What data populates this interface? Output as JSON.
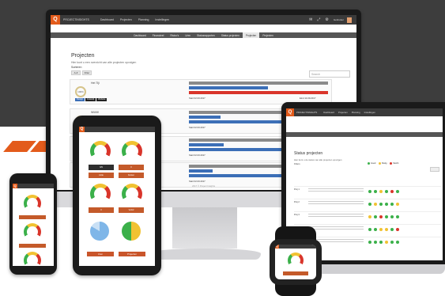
{
  "brand": {
    "logo_letter": "Q",
    "name": "PROJECTINSIGHTS"
  },
  "colors": {
    "accent": "#e35b1b",
    "dark_bar": "#3a3a3a",
    "sub_bar": "#555555",
    "gantt_blue": "#3c6fb7",
    "gantt_red": "#d9352b",
    "gantt_gray": "#8a8a8a"
  },
  "monitor": {
    "top_nav": [
      "Dashboard",
      "Projecten",
      "Planning",
      "Instellingen"
    ],
    "user_label": "Gebruiker",
    "sub_nav": [
      "Dashboard",
      "Financieel",
      "Risico's",
      "Uren",
      "Statusrapporten",
      "Status projecten",
      "Projecten",
      "Projecten"
    ],
    "active_sub_index": 6,
    "page_title": "Projecten",
    "page_subtitle": "Hier kunt u een overzicht van alle projecten opvolgen",
    "sort_label": "Sorteren",
    "sort_buttons": [
      "A-Z",
      "Filter"
    ],
    "search_placeholder": "Search",
    "rows": [
      {
        "name": "Het Tiji",
        "percent": "100%",
        "start": "Start 02.03.2017",
        "end": "Eind 14.09.2017"
      },
      {
        "name": "WWW",
        "percent": "100%",
        "start": "Start 02.03.2017",
        "end": ""
      },
      {
        "name": "",
        "percent": "",
        "start": "Start 02.03.2017",
        "end": ""
      },
      {
        "name": "",
        "percent": "",
        "start": "Start 02.03.2017",
        "end": ""
      }
    ],
    "tags": [
      "Design",
      "Huisstijl",
      "Website",
      "Bestuur"
    ],
    "footer": "2017 © Project Insights"
  },
  "tablet": {
    "tiles": [
      "6/9",
      "0",
      "Actie",
      "Kosten",
      "0",
      "Verlof"
    ],
    "buttons": [
      "Uren",
      "Projecten"
    ]
  },
  "laptop": {
    "top_nav": [
      "Dashboard",
      "Projecten",
      "Planning",
      "Instellingen"
    ],
    "page_title": "Status projecten",
    "page_subtitle": "Hier kunt u de status van alle projecten opvolgen",
    "filter_label": "Filters",
    "legend": [
      "Goed",
      "Matig",
      "Slecht"
    ],
    "rows": [
      "Proj 1",
      "Proj 2",
      "Proj 3",
      "Proj 4",
      "Proj 5"
    ]
  }
}
